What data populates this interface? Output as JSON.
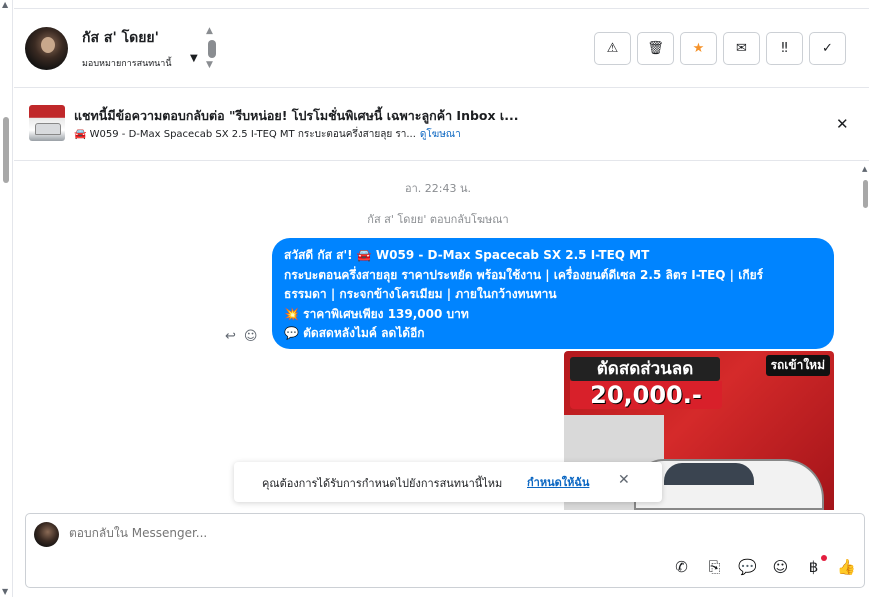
{
  "header": {
    "contact_name": "กัส ส' โดยย'",
    "assign_label": "มอบหมายการสนทนานี้",
    "actions": [
      {
        "icon": "warning-icon",
        "glyph": "⚠"
      },
      {
        "icon": "trash-icon",
        "glyph": "🗑"
      },
      {
        "icon": "star-icon",
        "glyph": "★"
      },
      {
        "icon": "envelope-icon",
        "glyph": "✉"
      },
      {
        "icon": "follow-up-icon",
        "glyph": "‼"
      },
      {
        "icon": "check-icon",
        "glyph": "✓"
      }
    ]
  },
  "banner": {
    "title": "แชทนี้มีข้อความตอบกลับต่อ \"รีบหน่อย! โปรโมชั่นพิเศษนี้ เฉพาะลูกค้า Inbox เ...",
    "subtitle": "🚘 W059 - D-Max Spacecab SX 2.5 I-TEQ MT กระบะตอนครึ่งสายลุย รา...",
    "ad_link": "ดูโฆษณา"
  },
  "chat": {
    "timestamp": "อา. 22:43 น.",
    "replied_note": "กัส ส' โดยย' ตอบกลับโฆษณา",
    "bubble_lines": [
      "สวัสดี กัส ส'! 🚘 W059 - D-Max Spacecab SX 2.5 I-TEQ MT",
      "กระบะตอนครึ่งสายลุย ราคาประหยัด พร้อมใช้งาน | เครื่องยนต์ดีเซล 2.5 ลิตร I-TEQ | เกียร์",
      "ธรรมดา | กระจกข้างโครเมียม | ภายในกว้างทนทาน",
      "💥 ราคาพิเศษเพียง 139,000 บาท",
      "💬 ตัดสดหลังไมค์ ลดได้อีก"
    ],
    "promo": {
      "headline": "ตัดสดส่วนลด",
      "amount": "20,000.-",
      "tag": "รถเข้าใหม่"
    }
  },
  "notice": {
    "text": "คุณต้องการได้รับการกำหนดไปยังการสนทนานี้ไหม",
    "link": "กำหนดให้ฉัน"
  },
  "composer": {
    "placeholder": "ตอบกลับใน Messenger...",
    "tools": [
      "phone-add-icon",
      "attachment-icon",
      "saved-reply-icon",
      "emoji-icon",
      "baht-icon",
      "thumbs-up-icon"
    ]
  }
}
